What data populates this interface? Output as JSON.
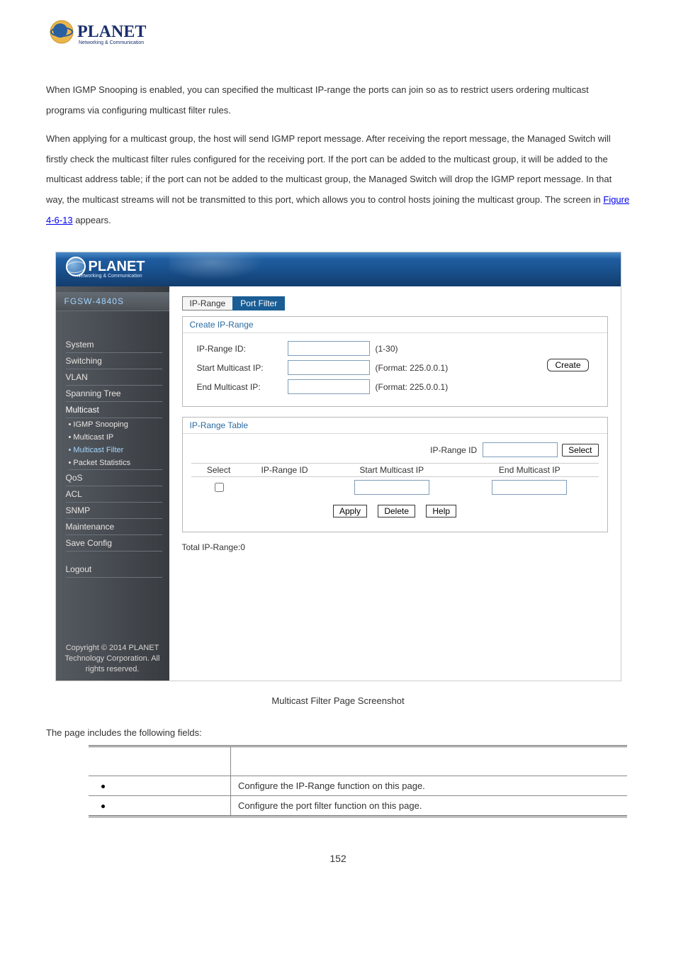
{
  "logo_text": "PLANET",
  "logo_tag": "Networking & Communication",
  "paragraph1": "When IGMP Snooping is enabled, you can specified the multicast IP-range the ports can join so as to restrict users ordering multicast programs via configuring multicast filter rules.",
  "paragraph2a": "When applying for a multicast group, the host will send IGMP report message. After receiving the report message, the Managed Switch will firstly check the multicast filter rules configured for the receiving port. If the port can be added to the multicast group, it will be added to the multicast address table; if the port can not be added to the multicast group, the Managed Switch will drop the IGMP report message. In that way, the multicast streams will not be transmitted to this port, which allows you to control hosts joining the multicast group. The screen in ",
  "fig_link": "Figure 4-6-13",
  "paragraph2b": " appears.",
  "model": "FGSW-4840S",
  "tabs": {
    "ip_range": "IP-Range",
    "port_filter": "Port Filter"
  },
  "sidebar_items": [
    "System",
    "Switching",
    "VLAN",
    "Spanning Tree",
    "Multicast"
  ],
  "sidebar_sub": [
    "• IGMP Snooping",
    "• Multicast IP",
    "• Multicast Filter",
    "• Packet Statistics"
  ],
  "sidebar_items2": [
    "QoS",
    "ACL",
    "SNMP",
    "Maintenance",
    "Save Config"
  ],
  "sidebar_logout": "Logout",
  "sidebar_copy": "Copyright © 2014 PLANET Technology Corporation. All rights reserved.",
  "panel_create": {
    "title": "Create IP-Range",
    "row_id": "IP-Range ID:",
    "row_id_hint": "(1-30)",
    "row_start": "Start Multicast IP:",
    "row_start_hint": "(Format: 225.0.0.1)",
    "row_end": "End Multicast IP:",
    "row_end_hint": "(Format: 225.0.0.1)",
    "btn_create": "Create"
  },
  "panel_table": {
    "title": "IP-Range Table",
    "search_lbl": "IP-Range ID",
    "btn_select": "Select",
    "col_select": "Select",
    "col_id": "IP-Range ID",
    "col_start": "Start Multicast IP",
    "col_end": "End Multicast IP",
    "btn_apply": "Apply",
    "btn_delete": "Delete",
    "btn_help": "Help"
  },
  "total": "Total IP-Range:0",
  "caption": "Multicast Filter Page Screenshot",
  "fields_intro": "The page includes the following fields:",
  "field_rows": [
    "Configure the IP-Range function on this page.",
    "Configure the port filter function on this page."
  ],
  "page_number": "152"
}
